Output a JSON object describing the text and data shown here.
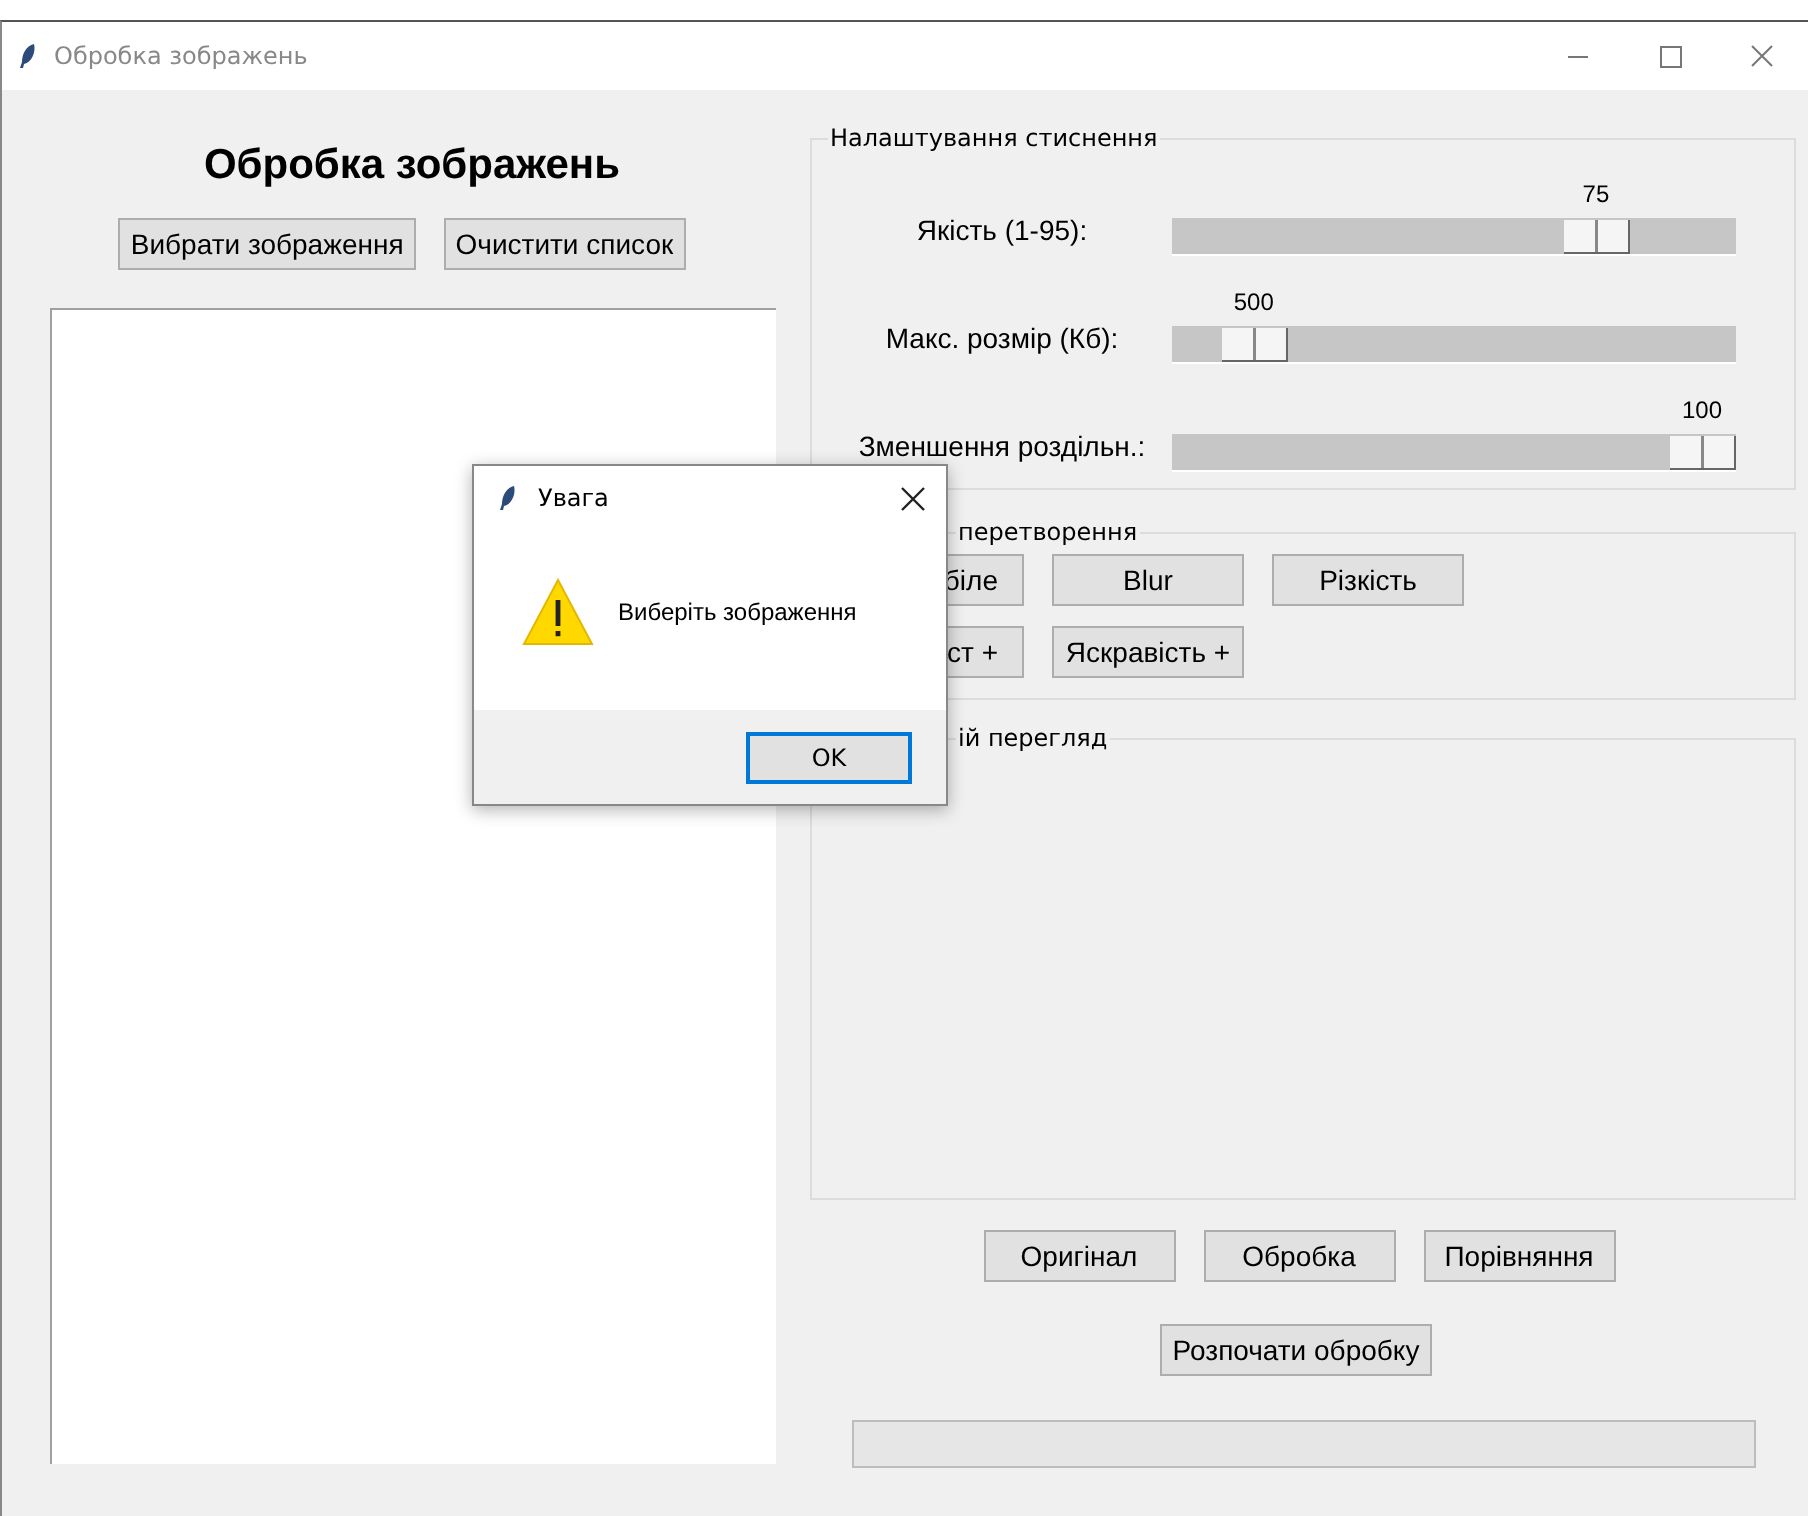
{
  "window": {
    "title": "Обробка зображень"
  },
  "left": {
    "heading": "Обробка зображень",
    "buttons": [
      "Вибрати зображення",
      "Очистити список"
    ]
  },
  "compression": {
    "title": "Налаштування стиснення",
    "sliders": [
      {
        "label": "Якість (1-95):",
        "reading": "75",
        "level": 0.787
      },
      {
        "label": "Макс. розмір (Кб):",
        "reading": "500",
        "level": 0.1
      },
      {
        "label": "Зменшення роздільн.:",
        "reading": "100",
        "level": 1.0
      }
    ]
  },
  "transform": {
    "title": "перетворення",
    "rows": [
      [
        "біле",
        "Blur",
        "Різкість"
      ],
      [
        "ст +",
        "Яскравість +"
      ]
    ]
  },
  "preview": {
    "title": "ій перегляд"
  },
  "view_buttons": [
    "Оригінал",
    "Обробка",
    "Порівняння"
  ],
  "start_button": "Розпочати обробку",
  "dialog": {
    "title": "Увага",
    "message": "Виберіть зображення",
    "button": "OK"
  }
}
